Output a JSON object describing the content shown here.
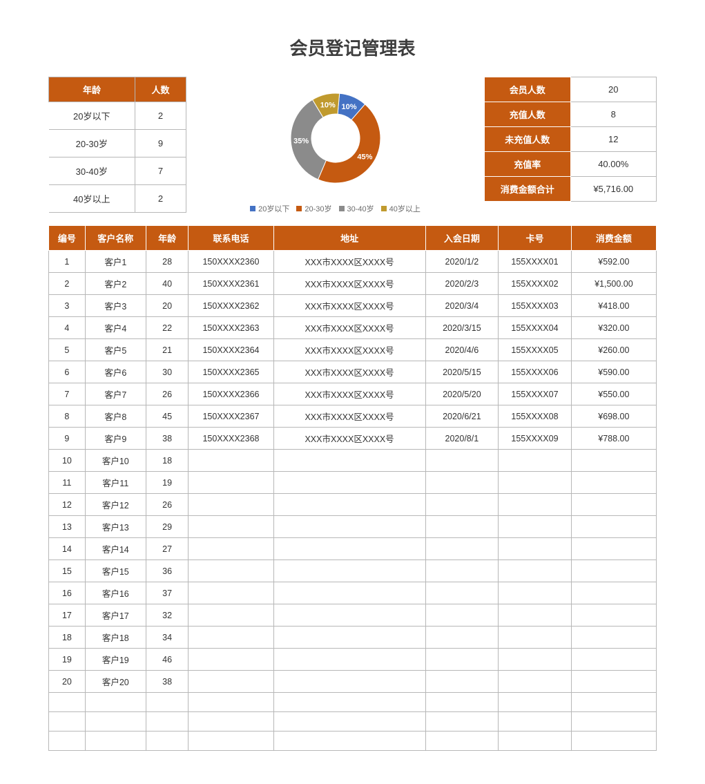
{
  "title": "会员登记管理表",
  "age_table": {
    "headers": [
      "年龄",
      "人数"
    ],
    "rows": [
      {
        "label": "20岁以下",
        "count": "2"
      },
      {
        "label": "20-30岁",
        "count": "9"
      },
      {
        "label": "30-40岁",
        "count": "7"
      },
      {
        "label": "40岁以上",
        "count": "2"
      }
    ]
  },
  "chart_data": {
    "type": "pie",
    "categories": [
      "20岁以下",
      "20-30岁",
      "30-40岁",
      "40岁以上"
    ],
    "values": [
      10,
      45,
      35,
      10
    ],
    "value_suffix": "%",
    "colors": [
      "#4472c4",
      "#c55a11",
      "#8b8b8b",
      "#c09a2e"
    ],
    "legend_position": "bottom",
    "donut": true
  },
  "legend": [
    "20岁以下",
    "20-30岁",
    "30-40岁",
    "40岁以上"
  ],
  "summary": {
    "rows": [
      {
        "label": "会员人数",
        "value": "20"
      },
      {
        "label": "充值人数",
        "value": "8"
      },
      {
        "label": "未充值人数",
        "value": "12"
      },
      {
        "label": "充值率",
        "value": "40.00%"
      },
      {
        "label": "消费金额合计",
        "value": "¥5,716.00"
      }
    ]
  },
  "main_table": {
    "headers": [
      "编号",
      "客户名称",
      "年龄",
      "联系电话",
      "地址",
      "入会日期",
      "卡号",
      "消费金额"
    ],
    "rows": [
      {
        "no": "1",
        "name": "客户1",
        "age": "28",
        "tel": "150XXXX2360",
        "addr": "XXX市XXXX区XXXX号",
        "date": "2020/1/2",
        "card": "155XXXX01",
        "amt": "¥592.00"
      },
      {
        "no": "2",
        "name": "客户2",
        "age": "40",
        "tel": "150XXXX2361",
        "addr": "XXX市XXXX区XXXX号",
        "date": "2020/2/3",
        "card": "155XXXX02",
        "amt": "¥1,500.00"
      },
      {
        "no": "3",
        "name": "客户3",
        "age": "20",
        "tel": "150XXXX2362",
        "addr": "XXX市XXXX区XXXX号",
        "date": "2020/3/4",
        "card": "155XXXX03",
        "amt": "¥418.00"
      },
      {
        "no": "4",
        "name": "客户4",
        "age": "22",
        "tel": "150XXXX2363",
        "addr": "XXX市XXXX区XXXX号",
        "date": "2020/3/15",
        "card": "155XXXX04",
        "amt": "¥320.00"
      },
      {
        "no": "5",
        "name": "客户5",
        "age": "21",
        "tel": "150XXXX2364",
        "addr": "XXX市XXXX区XXXX号",
        "date": "2020/4/6",
        "card": "155XXXX05",
        "amt": "¥260.00"
      },
      {
        "no": "6",
        "name": "客户6",
        "age": "30",
        "tel": "150XXXX2365",
        "addr": "XXX市XXXX区XXXX号",
        "date": "2020/5/15",
        "card": "155XXXX06",
        "amt": "¥590.00"
      },
      {
        "no": "7",
        "name": "客户7",
        "age": "26",
        "tel": "150XXXX2366",
        "addr": "XXX市XXXX区XXXX号",
        "date": "2020/5/20",
        "card": "155XXXX07",
        "amt": "¥550.00"
      },
      {
        "no": "8",
        "name": "客户8",
        "age": "45",
        "tel": "150XXXX2367",
        "addr": "XXX市XXXX区XXXX号",
        "date": "2020/6/21",
        "card": "155XXXX08",
        "amt": "¥698.00"
      },
      {
        "no": "9",
        "name": "客户9",
        "age": "38",
        "tel": "150XXXX2368",
        "addr": "XXX市XXXX区XXXX号",
        "date": "2020/8/1",
        "card": "155XXXX09",
        "amt": "¥788.00"
      },
      {
        "no": "10",
        "name": "客户10",
        "age": "18",
        "tel": "",
        "addr": "",
        "date": "",
        "card": "",
        "amt": ""
      },
      {
        "no": "11",
        "name": "客户11",
        "age": "19",
        "tel": "",
        "addr": "",
        "date": "",
        "card": "",
        "amt": ""
      },
      {
        "no": "12",
        "name": "客户12",
        "age": "26",
        "tel": "",
        "addr": "",
        "date": "",
        "card": "",
        "amt": ""
      },
      {
        "no": "13",
        "name": "客户13",
        "age": "29",
        "tel": "",
        "addr": "",
        "date": "",
        "card": "",
        "amt": ""
      },
      {
        "no": "14",
        "name": "客户14",
        "age": "27",
        "tel": "",
        "addr": "",
        "date": "",
        "card": "",
        "amt": ""
      },
      {
        "no": "15",
        "name": "客户15",
        "age": "36",
        "tel": "",
        "addr": "",
        "date": "",
        "card": "",
        "amt": ""
      },
      {
        "no": "16",
        "name": "客户16",
        "age": "37",
        "tel": "",
        "addr": "",
        "date": "",
        "card": "",
        "amt": ""
      },
      {
        "no": "17",
        "name": "客户17",
        "age": "32",
        "tel": "",
        "addr": "",
        "date": "",
        "card": "",
        "amt": ""
      },
      {
        "no": "18",
        "name": "客户18",
        "age": "34",
        "tel": "",
        "addr": "",
        "date": "",
        "card": "",
        "amt": ""
      },
      {
        "no": "19",
        "name": "客户19",
        "age": "46",
        "tel": "",
        "addr": "",
        "date": "",
        "card": "",
        "amt": ""
      },
      {
        "no": "20",
        "name": "客户20",
        "age": "38",
        "tel": "",
        "addr": "",
        "date": "",
        "card": "",
        "amt": ""
      },
      {
        "no": "",
        "name": "",
        "age": "",
        "tel": "",
        "addr": "",
        "date": "",
        "card": "",
        "amt": ""
      },
      {
        "no": "",
        "name": "",
        "age": "",
        "tel": "",
        "addr": "",
        "date": "",
        "card": "",
        "amt": ""
      },
      {
        "no": "",
        "name": "",
        "age": "",
        "tel": "",
        "addr": "",
        "date": "",
        "card": "",
        "amt": ""
      }
    ]
  }
}
